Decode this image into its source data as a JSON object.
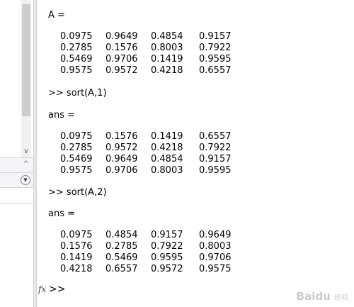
{
  "left_panel": {
    "scroll_down_glyph": "∨",
    "bar1_glyph": "^",
    "bar2_glyph": "▼"
  },
  "command_window": {
    "blocks": [
      {
        "header": "A =",
        "rows": [
          [
            "0.0975",
            "0.9649",
            "0.4854",
            "0.9157"
          ],
          [
            "0.2785",
            "0.1576",
            "0.8003",
            "0.7922"
          ],
          [
            "0.5469",
            "0.9706",
            "0.1419",
            "0.9595"
          ],
          [
            "0.9575",
            "0.9572",
            "0.4218",
            "0.6557"
          ]
        ]
      },
      {
        "command": ">> sort(A,1)",
        "header": "ans =",
        "rows": [
          [
            "0.0975",
            "0.1576",
            "0.1419",
            "0.6557"
          ],
          [
            "0.2785",
            "0.9572",
            "0.4218",
            "0.7922"
          ],
          [
            "0.5469",
            "0.9649",
            "0.4854",
            "0.9157"
          ],
          [
            "0.9575",
            "0.9706",
            "0.8003",
            "0.9595"
          ]
        ]
      },
      {
        "command": ">> sort(A,2)",
        "header": "ans =",
        "rows": [
          [
            "0.0975",
            "0.4854",
            "0.9157",
            "0.9649"
          ],
          [
            "0.1576",
            "0.2785",
            "0.7922",
            "0.8003"
          ],
          [
            "0.1419",
            "0.5469",
            "0.9595",
            "0.9706"
          ],
          [
            "0.4218",
            "0.6557",
            "0.9572",
            "0.9575"
          ]
        ]
      }
    ],
    "fx_label": "fx",
    "prompt": ">>"
  },
  "watermark": {
    "brand": "Baidu",
    "sub": "经验"
  }
}
